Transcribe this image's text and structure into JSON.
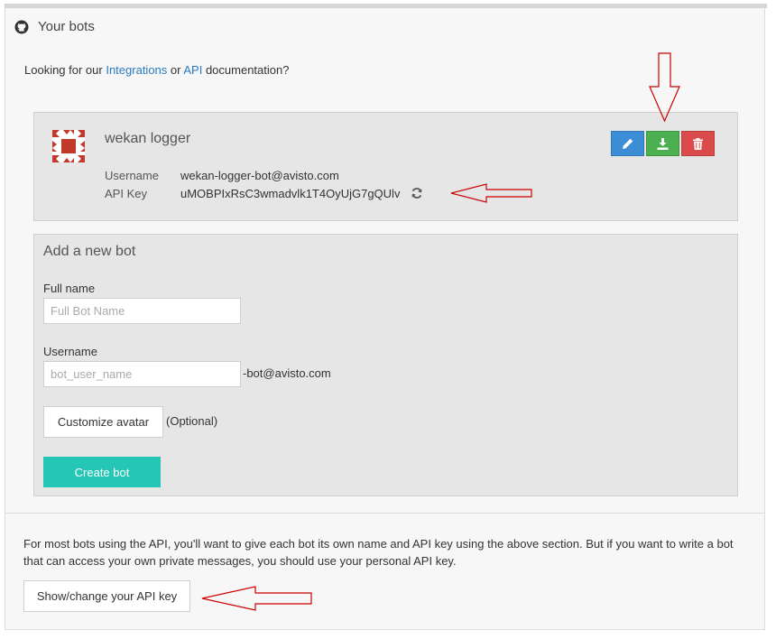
{
  "header": {
    "title": "Your bots",
    "icon": "github-icon"
  },
  "intro": {
    "prefix": "Looking for our ",
    "integrations_link": "Integrations",
    "middle": " or ",
    "api_link": "API",
    "suffix": " documentation?"
  },
  "bot": {
    "name": "wekan logger",
    "username_label": "Username",
    "username": "wekan-logger-bot@avisto.com",
    "api_key_label": "API Key",
    "api_key": "uMOBPIxRsC3wmadvlk1T4OyUjG7gQUlv",
    "actions": [
      {
        "name": "edit",
        "icon": "pencil-icon",
        "color": "#3b8ed6"
      },
      {
        "name": "download",
        "icon": "download-icon",
        "color": "#4caf50"
      },
      {
        "name": "delete",
        "icon": "trash-icon",
        "color": "#dc4b4b"
      }
    ]
  },
  "new_bot": {
    "title": "Add a new bot",
    "full_name_label": "Full name",
    "full_name_placeholder": "Full Bot Name",
    "full_name_value": "",
    "username_label": "Username",
    "username_placeholder": "bot_user_name",
    "username_value": "",
    "username_suffix": "-bot@avisto.com",
    "customize_avatar_label": "Customize avatar",
    "optional_label": "(Optional)",
    "create_label": "Create bot"
  },
  "footer": {
    "text": "For most bots using the API, you'll want to give each bot its own name and API key using the above section. But if you want to write a bot that can access your own private messages, you should use your personal API key.",
    "api_key_button": "Show/change your API key"
  },
  "colors": {
    "accent": "#26c6b7",
    "link": "#2a7bbf",
    "annotation": "#cc0000"
  }
}
